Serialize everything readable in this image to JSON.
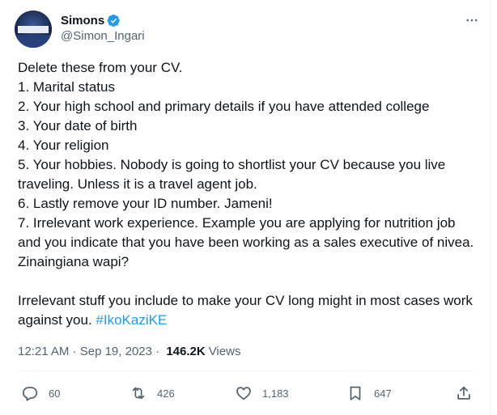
{
  "author": {
    "display_name": "Simons",
    "handle": "@Simon_Ingari"
  },
  "tweet": {
    "lines": [
      "Delete these from your CV.",
      "1. Marital status",
      "2. Your high school and primary details if you have attended college",
      "3. Your date of birth",
      "4. Your religion",
      "5. Your hobbies. Nobody is going to shortlist your CV because you live traveling. Unless it is a travel agent job.",
      "6. Lastly remove your ID number. Jameni!",
      "7. Irrelevant work experience. Example you are applying for nutrition job and you indicate that you have been working as a sales executive of nivea.  Zinaingiana wapi?"
    ],
    "closing": "Irrelevant stuff you include to make your CV long might in most cases work against you. ",
    "hashtag": "#IkoKaziKE"
  },
  "meta": {
    "time": "12:21 AM",
    "separator": " · ",
    "date": "Sep 19, 2023",
    "dot": " · ",
    "views_count": "146.2K",
    "views_label": "Views"
  },
  "actions": {
    "replies": "60",
    "retweets": "426",
    "likes": "1,183",
    "bookmarks": "647"
  },
  "colors": {
    "accent": "#1d9bf0",
    "text": "#0f1419",
    "secondary": "#536471"
  }
}
